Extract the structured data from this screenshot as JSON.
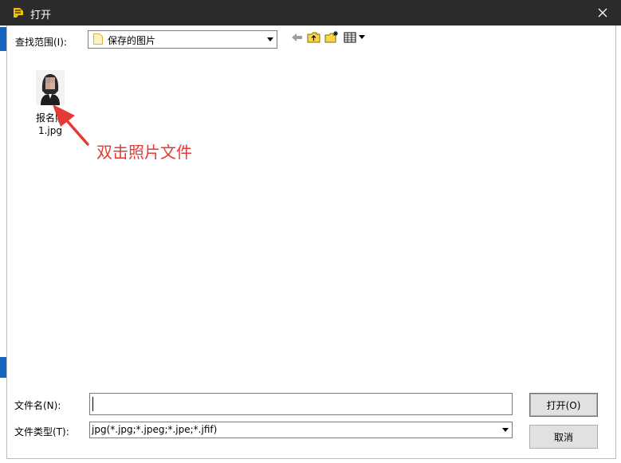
{
  "window": {
    "title": "打开"
  },
  "toolbar": {
    "look_in_label": "查找范围(I):",
    "look_in_value": "保存的图片"
  },
  "files": [
    {
      "name_line1": "报名照",
      "name_line2": "1.jpg"
    }
  ],
  "annotation": {
    "text": "双击照片文件",
    "color": "#e53935"
  },
  "filename": {
    "label": "文件名(N):",
    "value": ""
  },
  "filetype": {
    "label": "文件类型(T):",
    "value": "jpg(*.jpg;*.jpeg;*.jpe;*.jfif)"
  },
  "buttons": {
    "open": "打开(O)",
    "cancel": "取消"
  },
  "colors": {
    "titlebar": "#2b2b2b",
    "accent": "#1565c0",
    "annotation": "#e53935"
  }
}
